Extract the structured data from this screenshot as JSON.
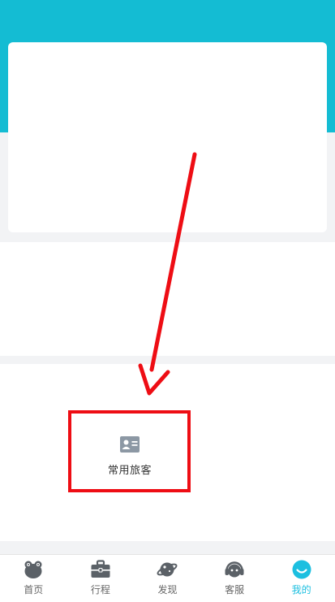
{
  "colors": {
    "header_bg": "#14bcd3",
    "accent": "#1cbfe0",
    "annotation_red": "#ee0d14",
    "icon_gray": "#8c98a4"
  },
  "shortcuts": {
    "frequent_passengers": {
      "label": "常用旅客",
      "icon": "id-card-icon"
    }
  },
  "tabbar": {
    "items": [
      {
        "label": "首页",
        "icon": "home-mascot-icon",
        "active": false
      },
      {
        "label": "行程",
        "icon": "briefcase-icon",
        "active": false
      },
      {
        "label": "发现",
        "icon": "planet-icon",
        "active": false
      },
      {
        "label": "客服",
        "icon": "headset-icon",
        "active": false
      },
      {
        "label": "我的",
        "icon": "smile-face-icon",
        "active": true
      }
    ]
  }
}
